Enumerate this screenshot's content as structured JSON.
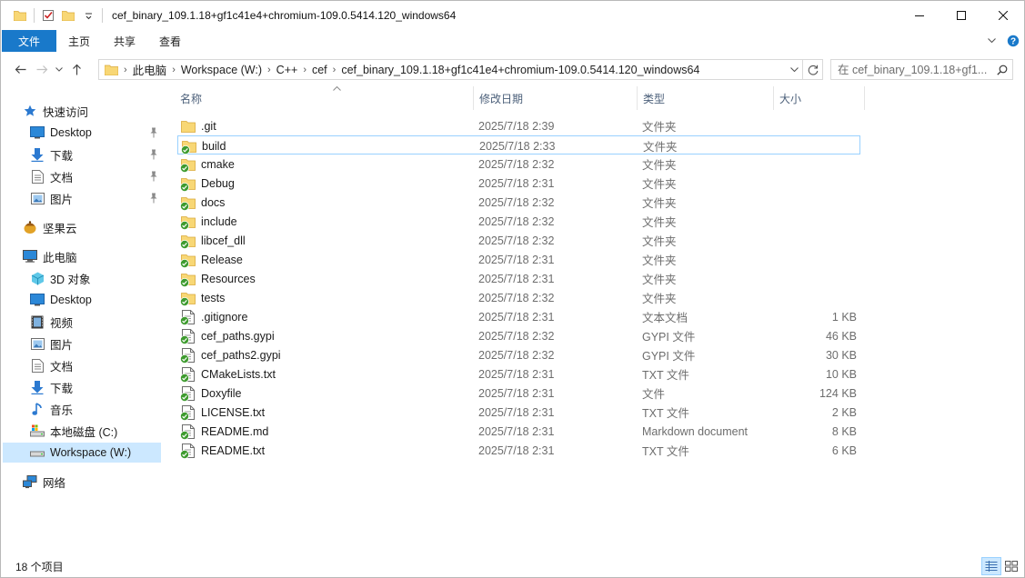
{
  "window": {
    "title": "cef_binary_109.1.18+gf1c41e4+chromium-109.0.5414.120_windows64"
  },
  "ribbon": {
    "tabs": [
      {
        "label": "文件"
      },
      {
        "label": "主页"
      },
      {
        "label": "共享"
      },
      {
        "label": "查看"
      }
    ]
  },
  "address": {
    "crumbs": [
      "此电脑",
      "Workspace (W:)",
      "C++",
      "cef",
      "cef_binary_109.1.18+gf1c41e4+chromium-109.0.5414.120_windows64"
    ]
  },
  "search": {
    "placeholder": "在 cef_binary_109.1.18+gf1..."
  },
  "nav": {
    "items": [
      {
        "label": "快速访问",
        "icon": "star-icon"
      },
      {
        "label": "Desktop",
        "icon": "desktop-icon",
        "pinned": true
      },
      {
        "label": "下载",
        "icon": "download-icon",
        "pinned": true
      },
      {
        "label": "文档",
        "icon": "document-icon",
        "pinned": true
      },
      {
        "label": "图片",
        "icon": "pictures-icon",
        "pinned": true
      },
      {
        "label": "坚果云",
        "icon": "nutstore-icon"
      },
      {
        "label": "此电脑",
        "icon": "computer-icon"
      },
      {
        "label": "3D 对象",
        "icon": "3d-objects-icon"
      },
      {
        "label": "Desktop",
        "icon": "desktop-icon"
      },
      {
        "label": "视频",
        "icon": "video-icon"
      },
      {
        "label": "图片",
        "icon": "pictures-icon"
      },
      {
        "label": "文档",
        "icon": "document-icon"
      },
      {
        "label": "下载",
        "icon": "download-icon"
      },
      {
        "label": "音乐",
        "icon": "music-icon"
      },
      {
        "label": "本地磁盘 (C:)",
        "icon": "drive-icon"
      },
      {
        "label": "Workspace (W:)",
        "icon": "drive-icon",
        "selected": true
      },
      {
        "label": "网络",
        "icon": "network-icon"
      }
    ]
  },
  "columns": {
    "name": "名称",
    "date": "修改日期",
    "type": "类型",
    "size": "大小"
  },
  "files": [
    {
      "name": ".git",
      "date": "2025/7/18 2:39",
      "type": "文件夹",
      "size": "",
      "kind": "folder",
      "synced": false
    },
    {
      "name": "build",
      "date": "2025/7/18 2:33",
      "type": "文件夹",
      "size": "",
      "kind": "folder",
      "synced": true
    },
    {
      "name": "cmake",
      "date": "2025/7/18 2:32",
      "type": "文件夹",
      "size": "",
      "kind": "folder",
      "synced": true
    },
    {
      "name": "Debug",
      "date": "2025/7/18 2:31",
      "type": "文件夹",
      "size": "",
      "kind": "folder",
      "synced": true
    },
    {
      "name": "docs",
      "date": "2025/7/18 2:32",
      "type": "文件夹",
      "size": "",
      "kind": "folder",
      "synced": true
    },
    {
      "name": "include",
      "date": "2025/7/18 2:32",
      "type": "文件夹",
      "size": "",
      "kind": "folder",
      "synced": true
    },
    {
      "name": "libcef_dll",
      "date": "2025/7/18 2:32",
      "type": "文件夹",
      "size": "",
      "kind": "folder",
      "synced": true
    },
    {
      "name": "Release",
      "date": "2025/7/18 2:31",
      "type": "文件夹",
      "size": "",
      "kind": "folder",
      "synced": true
    },
    {
      "name": "Resources",
      "date": "2025/7/18 2:31",
      "type": "文件夹",
      "size": "",
      "kind": "folder",
      "synced": true
    },
    {
      "name": "tests",
      "date": "2025/7/18 2:32",
      "type": "文件夹",
      "size": "",
      "kind": "folder",
      "synced": true
    },
    {
      "name": ".gitignore",
      "date": "2025/7/18 2:31",
      "type": "文本文档",
      "size": "1 KB",
      "kind": "file",
      "synced": true
    },
    {
      "name": "cef_paths.gypi",
      "date": "2025/7/18 2:32",
      "type": "GYPI 文件",
      "size": "46 KB",
      "kind": "file",
      "synced": true
    },
    {
      "name": "cef_paths2.gypi",
      "date": "2025/7/18 2:32",
      "type": "GYPI 文件",
      "size": "30 KB",
      "kind": "file",
      "synced": true
    },
    {
      "name": "CMakeLists.txt",
      "date": "2025/7/18 2:31",
      "type": "TXT 文件",
      "size": "10 KB",
      "kind": "file",
      "synced": true
    },
    {
      "name": "Doxyfile",
      "date": "2025/7/18 2:31",
      "type": "文件",
      "size": "124 KB",
      "kind": "file",
      "synced": true
    },
    {
      "name": "LICENSE.txt",
      "date": "2025/7/18 2:31",
      "type": "TXT 文件",
      "size": "2 KB",
      "kind": "file",
      "synced": true
    },
    {
      "name": "README.md",
      "date": "2025/7/18 2:31",
      "type": "Markdown document",
      "size": "8 KB",
      "kind": "file",
      "synced": true
    },
    {
      "name": "README.txt",
      "date": "2025/7/18 2:31",
      "type": "TXT 文件",
      "size": "6 KB",
      "kind": "file",
      "synced": true
    }
  ],
  "status": {
    "count": "18 个项目"
  },
  "colors": {
    "accent": "#1979ca",
    "selection": "#cce8ff",
    "focus_border": "#99d1ff",
    "folder": "#f8d775",
    "sync_green": "#3e9b2f"
  }
}
